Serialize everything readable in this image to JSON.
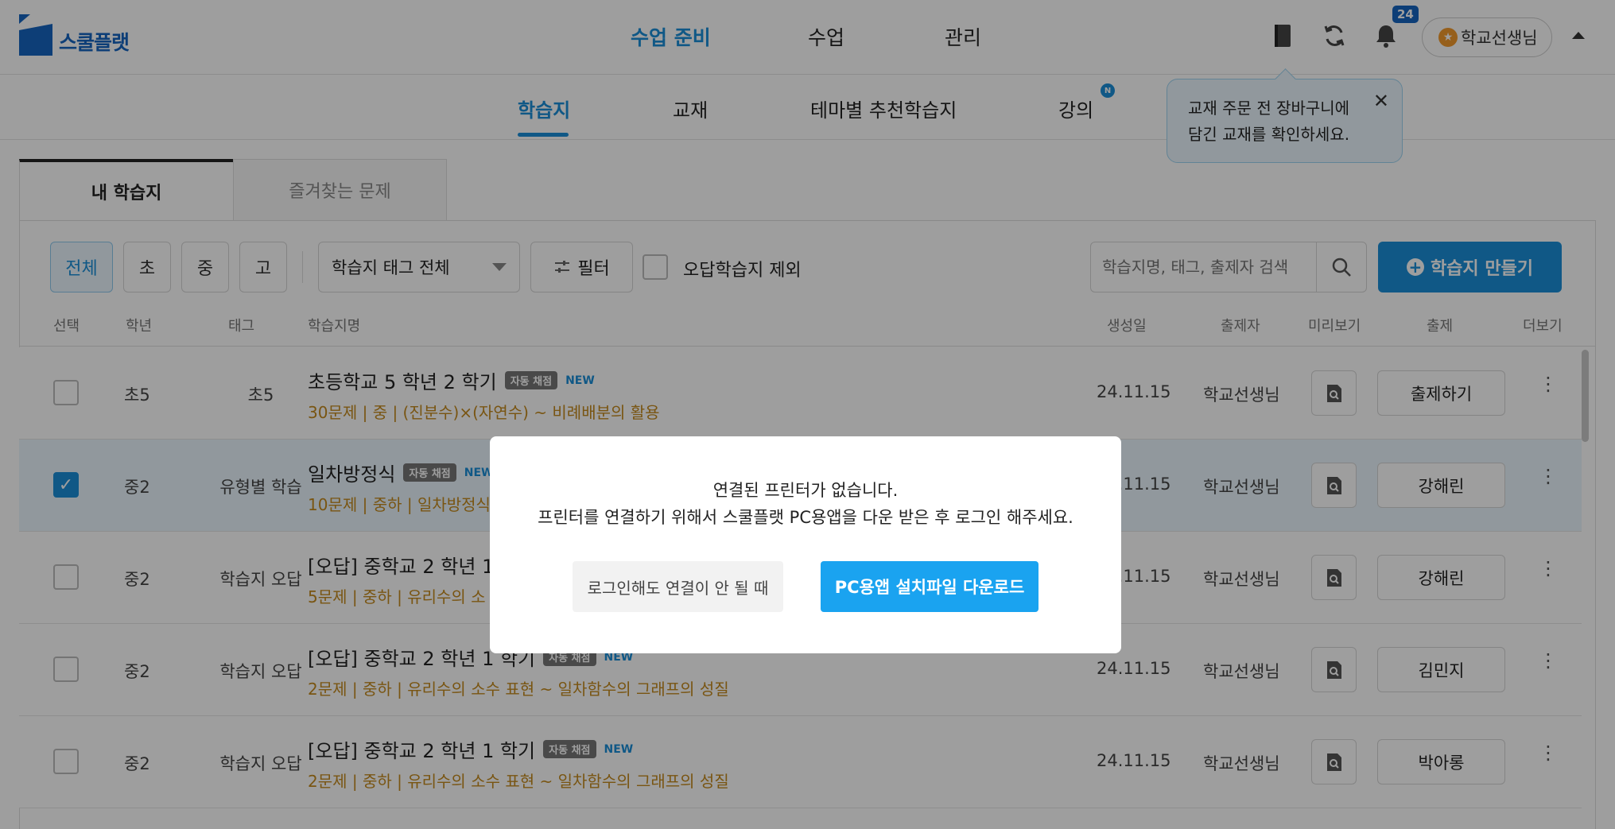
{
  "brand": {
    "name": "스쿨플랫"
  },
  "main_nav": [
    "수업 준비",
    "수업",
    "관리"
  ],
  "header": {
    "notification_count": "24",
    "user_name": "학교선생님"
  },
  "sub_nav": {
    "items": [
      "학습지",
      "교재",
      "테마별 추천학습지",
      "강의"
    ],
    "new_badge": "N"
  },
  "tooltip": {
    "line1": "교재 주문 전 장바구니에",
    "line2": "담긴 교재를 확인하세요."
  },
  "tabs": [
    "내 학습지",
    "즐겨찾는 문제"
  ],
  "filters": {
    "segments": [
      "전체",
      "초",
      "중",
      "고"
    ],
    "tag_select": "학습지 태그 전체",
    "filter_label": "필터",
    "exclude_label": "오답학습지 제외",
    "search_placeholder": "학습지명, 태그, 출제자 검색",
    "make_button": "학습지 만들기"
  },
  "table": {
    "headers": [
      "선택",
      "학년",
      "태그",
      "학습지명",
      "생성일",
      "출제자",
      "미리보기",
      "출제",
      "더보기"
    ],
    "auto_badge": "자동 채점",
    "new_label": "NEW",
    "rows": [
      {
        "checked": false,
        "grade": "초5",
        "tag": "초5",
        "title": "초등학교 5 학년 2 학기",
        "meta": "30문제 | 중 | (진분수)×(자연수) ~ 비례배분의 활용",
        "date": "24.11.15",
        "author": "학교선생님",
        "action": "출제하기"
      },
      {
        "checked": true,
        "grade": "중2",
        "tag": "유형별 학습",
        "title": "일차방정식",
        "meta": "10문제 | 중하 | 일차방정식",
        "date": "24.11.15",
        "author": "학교선생님",
        "action": "강해린"
      },
      {
        "checked": false,
        "grade": "중2",
        "tag": "학습지 오답",
        "title": "[오답] 중학교 2 학년 1",
        "meta": "5문제 | 중하 | 유리수의 소",
        "date": "24.11.15",
        "author": "학교선생님",
        "action": "강해린"
      },
      {
        "checked": false,
        "grade": "중2",
        "tag": "학습지 오답",
        "title": "[오답] 중학교 2 학년 1 학기",
        "meta": "2문제 | 중하 | 유리수의 소수 표현 ~ 일차함수의 그래프의 성질",
        "date": "24.11.15",
        "author": "학교선생님",
        "action": "김민지"
      },
      {
        "checked": false,
        "grade": "중2",
        "tag": "학습지 오답",
        "title": "[오답] 중학교 2 학년 1 학기",
        "meta": "2문제 | 중하 | 유리수의 소수 표현 ~ 일차함수의 그래프의 성질",
        "date": "24.11.15",
        "author": "학교선생님",
        "action": "박아롱"
      }
    ]
  },
  "modal": {
    "message1": "연결된 프린터가 없습니다.",
    "message2": "프린터를 연결하기 위해서 스쿨플랫 PC용앱을 다운 받은 후 로그인 해주세요.",
    "help_button": "로그인해도 연결이 안 될 때",
    "download_button": "PC용앱 설치파일 다운로드"
  }
}
